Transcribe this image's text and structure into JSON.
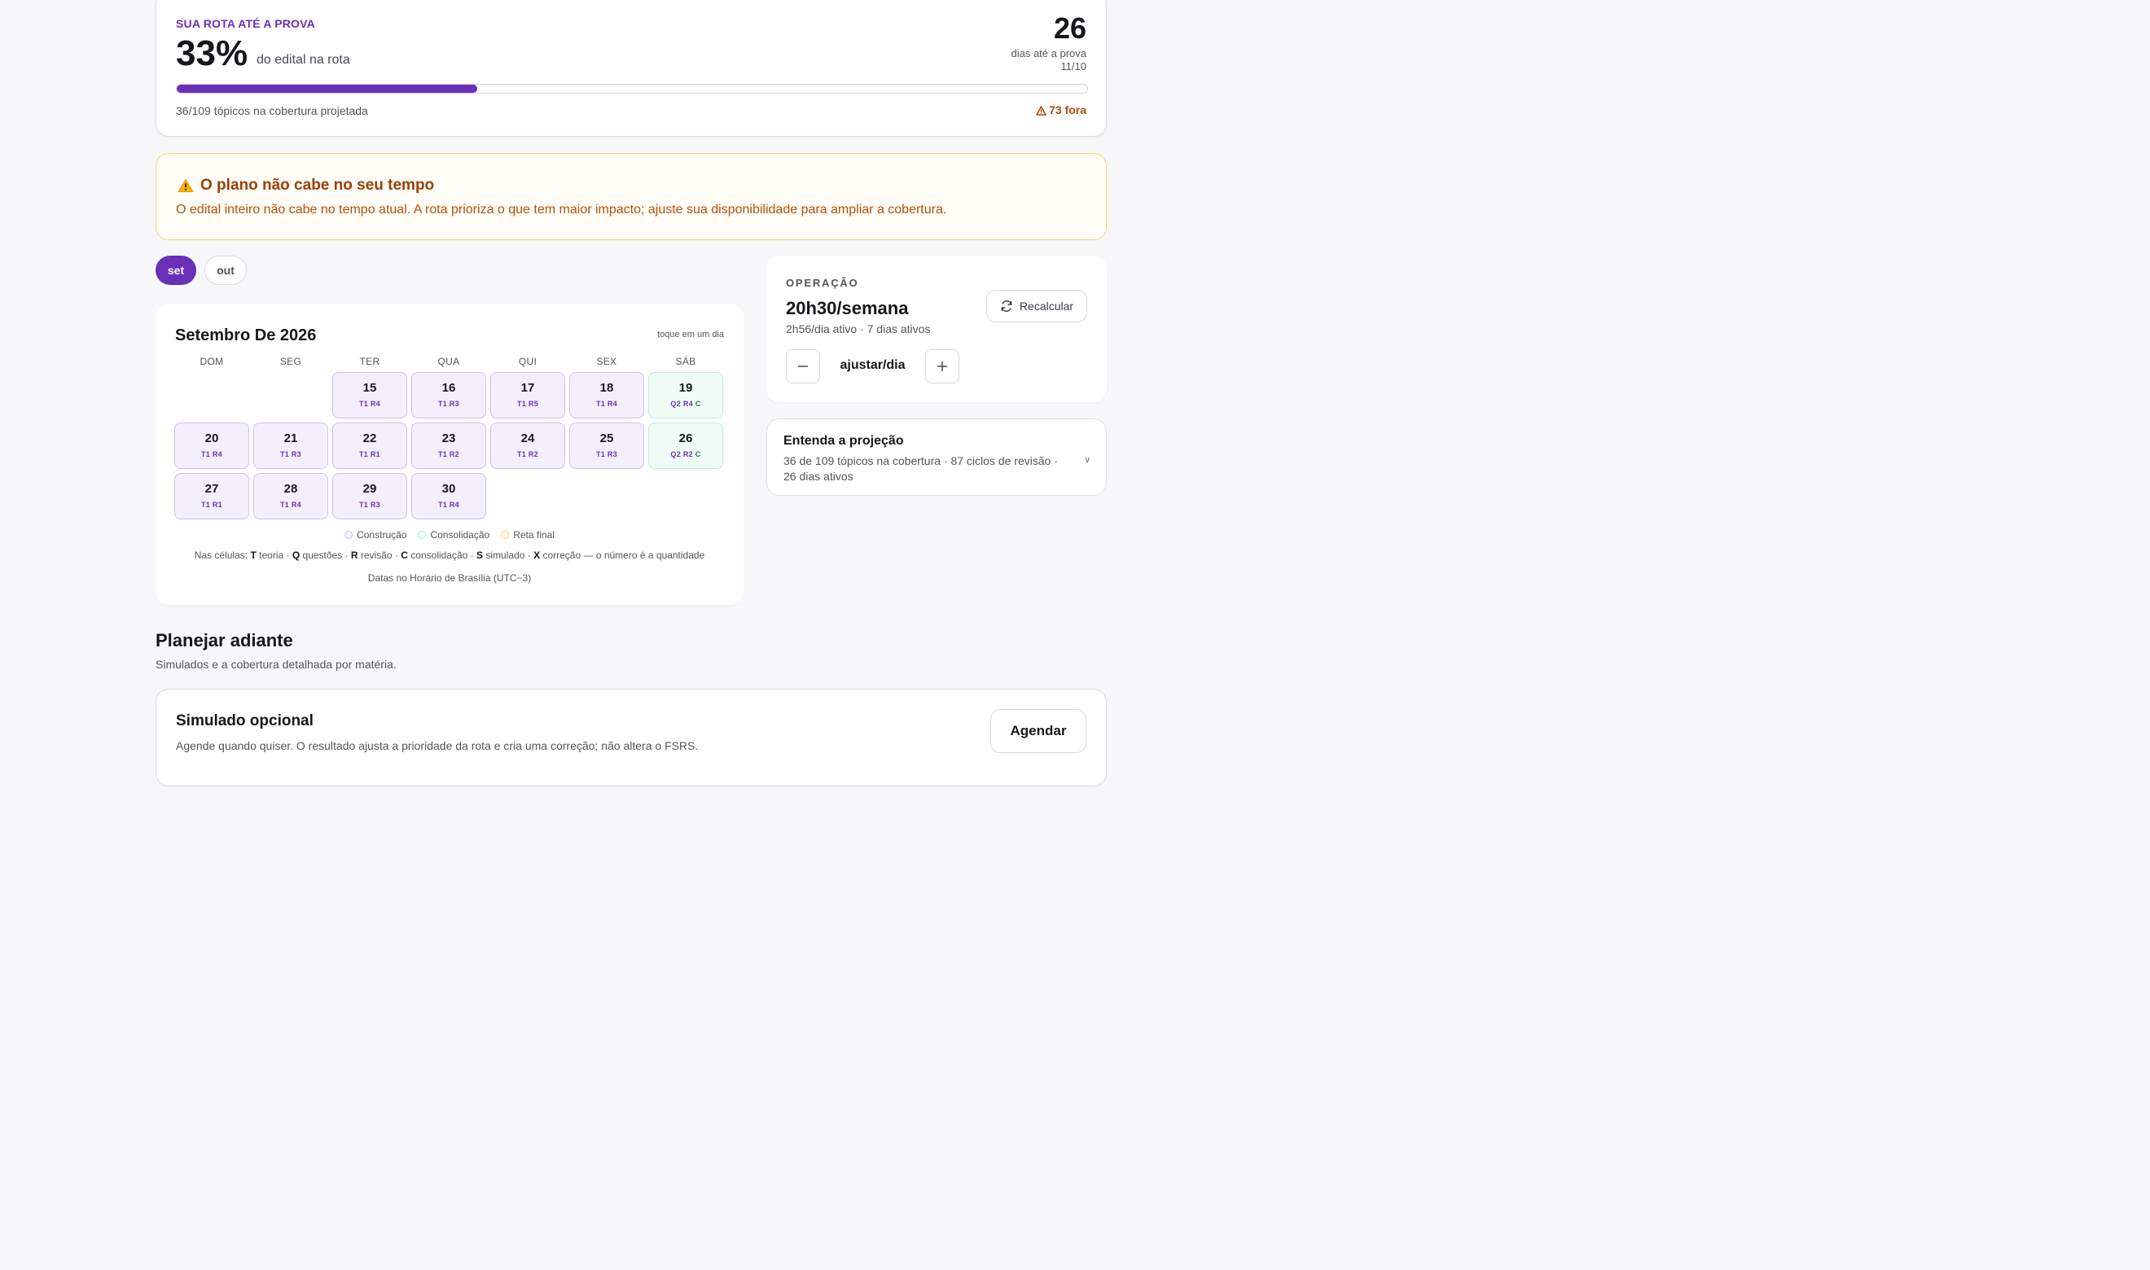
{
  "route": {
    "eyebrow": "SUA ROTA ATÉ A PROVA",
    "percent": "33%",
    "percent_label": "do edital na rota",
    "progress_fraction": 0.33,
    "days_left": "26",
    "days_label": "dias até a prova",
    "exam_date": "11/10",
    "coverage": "36/109 tópicos na cobertura projetada",
    "out_count": "73 fora"
  },
  "alert": {
    "title": "O plano não cabe no seu tempo",
    "text": "O edital inteiro não cabe no tempo atual. A rota prioriza o que tem maior impacto; ajuste sua disponibilidade para ampliar a cobertura."
  },
  "months": [
    {
      "label": "set",
      "active": true
    },
    {
      "label": "out",
      "active": false
    }
  ],
  "calendar": {
    "title": "Setembro De 2026",
    "hint": "toque em um dia",
    "weekdays": [
      "DOM",
      "SEG",
      "TER",
      "QUA",
      "QUI",
      "SEX",
      "SÁB"
    ],
    "leading_empty": 2,
    "days": [
      {
        "num": "15",
        "tag": "T1 R4",
        "phase": "build"
      },
      {
        "num": "16",
        "tag": "T1 R3",
        "phase": "build"
      },
      {
        "num": "17",
        "tag": "T1 R5",
        "phase": "build"
      },
      {
        "num": "18",
        "tag": "T1 R4",
        "phase": "build"
      },
      {
        "num": "19",
        "tag": "Q2 R4",
        "tag_c": "C",
        "phase": "cons"
      },
      {
        "num": "20",
        "tag": "T1 R4",
        "phase": "build"
      },
      {
        "num": "21",
        "tag": "T1 R3",
        "phase": "build"
      },
      {
        "num": "22",
        "tag": "T1 R1",
        "phase": "build"
      },
      {
        "num": "23",
        "tag": "T1 R2",
        "phase": "build"
      },
      {
        "num": "24",
        "tag": "T1 R2",
        "phase": "build"
      },
      {
        "num": "25",
        "tag": "T1 R3",
        "phase": "build"
      },
      {
        "num": "26",
        "tag": "Q2 R2",
        "tag_c": "C",
        "phase": "cons"
      },
      {
        "num": "27",
        "tag": "T1 R1",
        "phase": "build"
      },
      {
        "num": "28",
        "tag": "T1 R4",
        "phase": "build"
      },
      {
        "num": "29",
        "tag": "T1 R3",
        "phase": "build"
      },
      {
        "num": "30",
        "tag": "T1 R4",
        "phase": "build"
      }
    ],
    "legend": {
      "build": "Construção",
      "cons": "Consolidação",
      "final": "Reta final"
    },
    "key": {
      "prefix": "Nas células:",
      "items": [
        {
          "letter": "T",
          "word": "teoria"
        },
        {
          "letter": "Q",
          "word": "questões"
        },
        {
          "letter": "R",
          "word": "revisão"
        },
        {
          "letter": "C",
          "word": "consolidação"
        },
        {
          "letter": "S",
          "word": "simulado"
        },
        {
          "letter": "X",
          "word": "correção"
        }
      ],
      "suffix": "— o número é a quantidade"
    },
    "timezone": "Datas no Horário de Brasília (UTC−3)"
  },
  "operation": {
    "eyebrow": "OPERAÇÃO",
    "rate": "20h30/semana",
    "sub": "2h56/dia ativo · 7 dias ativos",
    "recalc_label": "Recalcular",
    "adjust_label": "ajustar/dia"
  },
  "projection": {
    "title": "Entenda a projeção",
    "text": "36 de 109 tópicos na cobertura · 87 ciclos de revisão · 26 dias ativos",
    "chevron": "v"
  },
  "plan_ahead": {
    "title": "Planejar adiante",
    "subtitle": "Simulados e a cobertura detalhada por matéria."
  },
  "simulado": {
    "title": "Simulado opcional",
    "text": "Agende quando quiser. O resultado ajusta a prioridade da rota e cria uma correção; não altera o FSRS.",
    "button": "Agendar"
  },
  "colors": {
    "accent": "#6a2fb8",
    "warning": "#b5500a",
    "consolidation": "#16784f"
  }
}
